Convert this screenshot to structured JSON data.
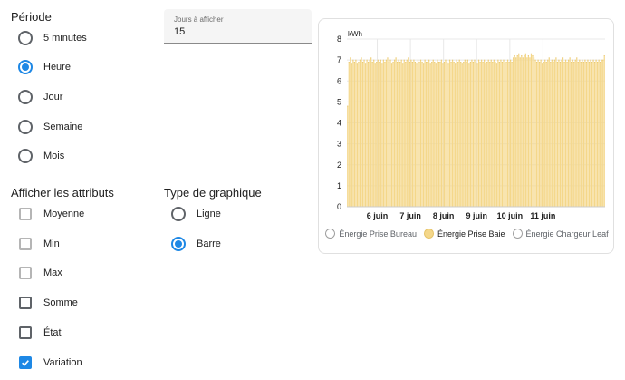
{
  "period": {
    "title": "Période",
    "options": [
      {
        "label": "5 minutes",
        "checked": false
      },
      {
        "label": "Heure",
        "checked": true
      },
      {
        "label": "Jour",
        "checked": false
      },
      {
        "label": "Semaine",
        "checked": false
      },
      {
        "label": "Mois",
        "checked": false
      }
    ]
  },
  "days_field": {
    "label": "Jours à afficher",
    "value": "15"
  },
  "attributes": {
    "title": "Afficher les attributs",
    "options": [
      {
        "label": "Moyenne",
        "checked": false,
        "disabled": true
      },
      {
        "label": "Min",
        "checked": false,
        "disabled": true
      },
      {
        "label": "Max",
        "checked": false,
        "disabled": true
      },
      {
        "label": "Somme",
        "checked": false,
        "disabled": false
      },
      {
        "label": "État",
        "checked": false,
        "disabled": false
      },
      {
        "label": "Variation",
        "checked": true,
        "disabled": false
      }
    ]
  },
  "chart_type": {
    "title": "Type de graphique",
    "options": [
      {
        "label": "Ligne",
        "checked": false
      },
      {
        "label": "Barre",
        "checked": true
      }
    ]
  },
  "colors": {
    "accent": "#1e88e5",
    "bar_fill": "#f4d78a",
    "bar_stroke": "#e8c56a"
  },
  "chart_data": {
    "type": "bar",
    "ylabel": "kWh",
    "ylim": [
      0,
      8
    ],
    "yticks": [
      "0",
      "1",
      "2",
      "3",
      "4",
      "5",
      "6",
      "7",
      "8"
    ],
    "x_ticks": [
      "6 juin",
      "7 juin",
      "8 juin",
      "9 juin",
      "10 juin",
      "11 juin"
    ],
    "x_start_hours_before_first_tick": 22,
    "x_end_hours_after_last_tick": 20,
    "series": [
      {
        "name": "Énergie Prise Bureau",
        "visible": false,
        "values": []
      },
      {
        "name": "Énergie Prise Baie",
        "visible": true,
        "values": [
          4.8,
          6.9,
          7.1,
          6.8,
          7.0,
          6.9,
          7.0,
          6.8,
          6.9,
          7.0,
          7.1,
          6.9,
          7.0,
          6.8,
          7.0,
          6.9,
          7.0,
          7.1,
          6.9,
          7.0,
          6.8,
          6.9,
          7.0,
          6.9,
          7.0,
          6.8,
          7.0,
          6.9,
          7.0,
          7.1,
          6.9,
          7.0,
          6.8,
          6.9,
          7.0,
          7.1,
          6.9,
          7.0,
          6.9,
          7.0,
          6.8,
          7.0,
          6.9,
          7.0,
          7.1,
          6.9,
          7.0,
          6.9,
          7.0,
          6.9,
          6.8,
          7.0,
          6.9,
          7.0,
          6.9,
          6.8,
          7.0,
          6.9,
          6.9,
          7.0,
          6.8,
          6.9,
          7.0,
          6.9,
          6.8,
          7.0,
          6.9,
          6.9,
          7.0,
          6.8,
          6.9,
          7.0,
          6.9,
          6.8,
          7.0,
          6.9,
          7.0,
          6.9,
          6.8,
          7.0,
          6.9,
          7.0,
          6.9,
          6.8,
          6.9,
          7.0,
          6.9,
          7.0,
          6.8,
          6.9,
          7.0,
          6.9,
          7.0,
          6.9,
          6.8,
          7.0,
          6.9,
          7.0,
          6.9,
          7.0,
          6.8,
          6.9,
          7.0,
          6.9,
          7.0,
          6.9,
          7.0,
          6.9,
          6.8,
          7.0,
          6.9,
          7.0,
          6.9,
          7.0,
          6.8,
          6.9,
          7.0,
          6.9,
          7.0,
          6.9,
          7.1,
          7.2,
          7.1,
          7.2,
          7.3,
          7.1,
          7.2,
          7.1,
          7.2,
          7.3,
          7.1,
          7.2,
          7.1,
          7.3,
          7.2,
          7.1,
          7.0,
          6.9,
          7.0,
          6.9,
          7.0,
          6.8,
          6.9,
          7.0,
          6.9,
          7.0,
          7.1,
          6.9,
          7.0,
          6.9,
          7.0,
          7.1,
          6.9,
          7.0,
          6.9,
          7.0,
          7.1,
          6.9,
          7.0,
          6.9,
          7.0,
          7.1,
          6.9,
          7.0,
          6.9,
          7.0,
          7.1,
          6.9,
          7.0,
          6.9,
          7.0,
          6.9,
          7.0,
          6.9,
          7.0,
          6.9,
          7.0,
          6.9,
          7.0,
          6.9,
          7.0,
          6.9,
          7.0,
          6.9,
          7.0,
          7.0,
          7.2
        ]
      },
      {
        "name": "Énergie Chargeur Leaf",
        "visible": false,
        "values": []
      }
    ],
    "legend_position": "bottom",
    "grid": true
  }
}
